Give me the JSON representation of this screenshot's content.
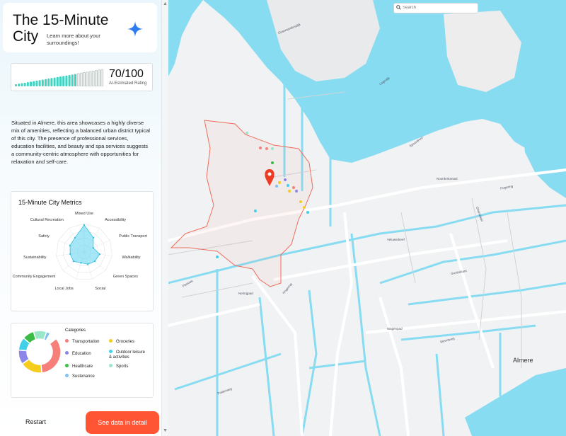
{
  "header": {
    "title": "The 15-Minute City",
    "subtitle": "Learn more about your surroundings!"
  },
  "rating": {
    "score": "70/100",
    "label": "AI-Estimated Rating",
    "value": 70,
    "max": 100
  },
  "description": "Situated in Almere, this area showcases a highly diverse mix of amenities, reflecting a balanced urban district typical of this city. The presence of professional services, education facilities, and beauty and spa services suggests a community-centric atmosphere with opportunities for relaxation and self-care.",
  "metrics": {
    "title": "15-Minute City Metrics",
    "axes": [
      "Mixed Use",
      "Accessibility",
      "Public Transport",
      "Walkability",
      "Green Spaces",
      "Social",
      "Local Jobs",
      "Community Engagement",
      "Sustainability",
      "Safety",
      "Cultural Recreation"
    ],
    "values": [
      0.95,
      0.6,
      0.35,
      0.55,
      0.5,
      0.45,
      0.4,
      0.5,
      0.5,
      0.55,
      0.6
    ]
  },
  "categories": {
    "title": "Categories",
    "items": [
      {
        "label": "Transportation",
        "color": "#f77f7a",
        "share": 0.34
      },
      {
        "label": "Groceries",
        "color": "#f6cc1d",
        "share": 0.17
      },
      {
        "label": "Education",
        "color": "#8b86e8",
        "share": 0.11
      },
      {
        "label": "Outdoor leisure & activities",
        "color": "#3fd0ea",
        "share": 0.1
      },
      {
        "label": "Healthcare",
        "color": "#3dbb47",
        "share": 0.09
      },
      {
        "label": "Sports",
        "color": "#9ae6c9",
        "share": 0.1
      },
      {
        "label": "Sustenance",
        "color": "#7fc1ec",
        "share": 0.03
      }
    ]
  },
  "buttons": {
    "restart": "Restart",
    "detail": "See data in detail"
  },
  "search": {
    "placeholder": "Search"
  },
  "map": {
    "water_color": "#87dcf2",
    "city_label": "Almere",
    "road_labels": [
      "Oostvaardersdijk",
      "Lagedijk",
      "Hogering",
      "Noorderkanaal",
      "Spoordreef",
      "Hogering",
      "Veluwedreef",
      "Gooisekant",
      "Ghandiaan",
      "Neringpad",
      "Fleetrak",
      "Wagenpad",
      "Meentweg",
      "Polderweg"
    ]
  },
  "colors": {
    "accent": "#ff5535",
    "sparkle": "#2e7df0",
    "radar_fill": "#5dd3f0",
    "rating_bar": "#3fd3c0"
  }
}
